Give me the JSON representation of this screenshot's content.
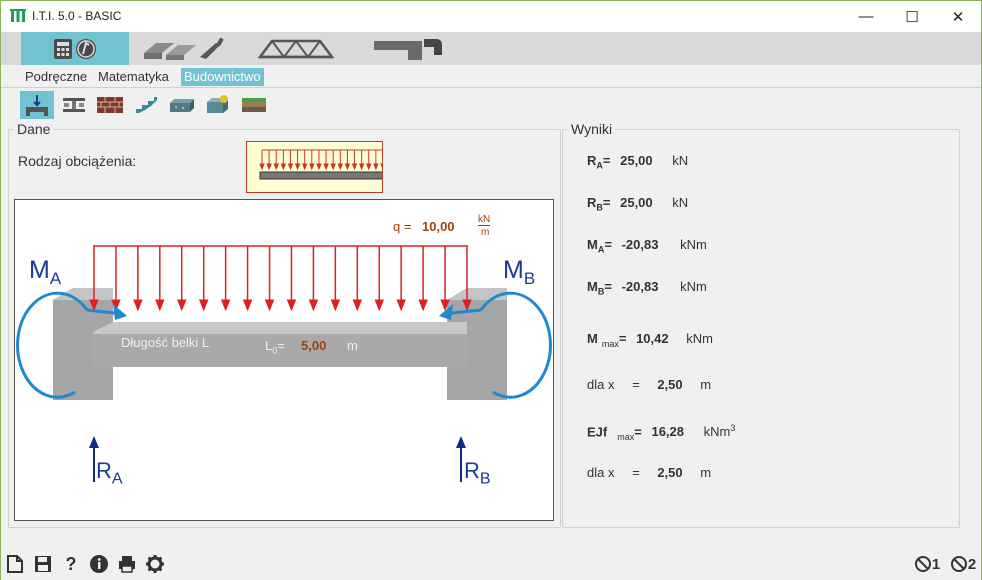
{
  "window": {
    "title": "I.T.I. 5.0 - BASIC",
    "minimize_glyph": "—",
    "maximize_glyph": "☐",
    "close_glyph": "✕"
  },
  "toolbar_top": [
    {
      "name": "calculator-tab-icon",
      "active": true
    },
    {
      "name": "masonry-tab-icon",
      "active": false
    },
    {
      "name": "truss-tab-icon",
      "active": false
    },
    {
      "name": "pipe-tab-icon",
      "active": false
    }
  ],
  "menu": [
    {
      "label": "Podręczne",
      "active": false
    },
    {
      "label": "Matematyka",
      "active": false
    },
    {
      "label": "Budownictwo",
      "active": true
    }
  ],
  "toolbar_tools": [
    {
      "name": "beam-load-icon",
      "active": true
    },
    {
      "name": "ibeam-section-icon",
      "active": false
    },
    {
      "name": "brick-wall-icon",
      "active": false
    },
    {
      "name": "stairs-icon",
      "active": false
    },
    {
      "name": "concrete-block-icon",
      "active": false
    },
    {
      "name": "insulation-icon",
      "active": false
    },
    {
      "name": "soil-layers-icon",
      "active": false
    }
  ],
  "dane": {
    "legend": "Dane",
    "load_type_label": "Rodzaj obciążenia:",
    "diagram": {
      "q_label": "q =",
      "q_value": "10,00",
      "q_unit_num": "kN",
      "q_unit_den": "m",
      "ma_label": "M",
      "ma_sub": "A",
      "mb_label": "M",
      "mb_sub": "B",
      "beam_label": "Długość belki L",
      "l0_label": "L",
      "l0_sub": "0",
      "l0_eq": "=",
      "l0_value": "5,00",
      "l0_unit": "m",
      "ra_label": "R",
      "ra_sub": "A",
      "rb_label": "R",
      "rb_sub": "B"
    }
  },
  "wyniki": {
    "legend": "Wyniki",
    "rows": [
      {
        "sym": "R",
        "sub": "A",
        "eq": "=",
        "value": "25,00",
        "unit": "kN",
        "sup": ""
      },
      {
        "sym": "R",
        "sub": "B",
        "eq": "=",
        "value": "25,00",
        "unit": "kN",
        "sup": ""
      },
      {
        "sym": "M",
        "sub": "A",
        "eq": "=",
        "value": "-20,83",
        "unit": "kNm",
        "sup": ""
      },
      {
        "sym": "M",
        "sub": "B",
        "eq": "=",
        "value": "-20,83",
        "unit": "kNm",
        "sup": ""
      },
      {
        "sym": "M",
        "sub": "max",
        "eq": "=",
        "value": "10,42",
        "unit": "kNm",
        "sup": ""
      },
      {
        "sym": "dla x",
        "sub": "",
        "eq": "=",
        "value": "2,50",
        "unit": "m",
        "sup": "",
        "plain": true
      },
      {
        "sym": "EJf",
        "sub": "max",
        "eq": "=",
        "value": "16,28",
        "unit": "kNm",
        "sup": "3"
      },
      {
        "sym": "dla x",
        "sub": "",
        "eq": "=",
        "value": "2,50",
        "unit": "m",
        "sup": "",
        "plain": true
      }
    ]
  },
  "statusbar": {
    "icons": [
      "new-document-icon",
      "save-icon",
      "help-icon",
      "info-icon",
      "print-icon",
      "settings-icon"
    ],
    "counter1": "1",
    "counter2": "2"
  },
  "colors": {
    "accent": "#72c3d1",
    "load_red": "#e02020",
    "moment_blue": "#1e88d0",
    "reaction_navy": "#0d2b8c",
    "value_brown": "#a0420a",
    "beam_gray": "#a6a6a6"
  }
}
